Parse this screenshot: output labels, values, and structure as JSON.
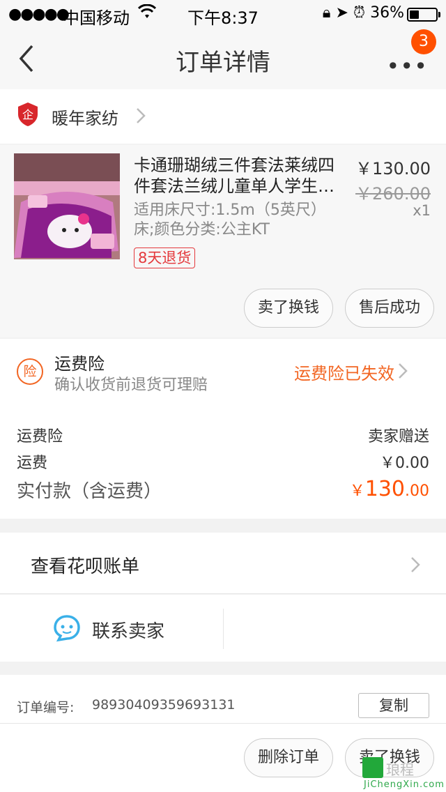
{
  "status_bar": {
    "signal": "●●●●●",
    "carrier": "中国移动",
    "time": "下午8:37",
    "battery_text": "36%",
    "battery_level": 0.36
  },
  "nav": {
    "title": "订单详情",
    "more": "•••",
    "badge": "3"
  },
  "shop": {
    "name": "暖年家纺"
  },
  "item": {
    "title_line1": "卡通珊瑚绒三件套法莱绒四",
    "title_line2": "件套法兰绒儿童单人学生…",
    "sku_line1": "适用床尺寸:1.5m（5英尺）",
    "sku_line2": "床;颜色分类:公主KT",
    "return_tag": "8天退货",
    "price": "￥130.00",
    "original_price": "￥260.00",
    "quantity": "x1",
    "buttons": {
      "resell": "卖了换钱",
      "after_sale": "售后成功"
    }
  },
  "insurance": {
    "icon_text": "险",
    "title": "运费险",
    "subtitle": "确认收货前退货可理赔",
    "status": "运费险已失效"
  },
  "fees": {
    "insurance_label": "运费险",
    "insurance_value": "卖家赠送",
    "shipping_label": "运费",
    "shipping_value": "￥0.00",
    "total_label": "实付款（含运费）",
    "total_currency": "￥",
    "total_int": "130",
    "total_dec": ".00"
  },
  "huabei": {
    "label": "查看花呗账单"
  },
  "contact": {
    "label": "联系卖家"
  },
  "order": {
    "number_label": "订单编号:",
    "number": "98930409359693131",
    "copy": "复制"
  },
  "bottom_actions": {
    "delete": "删除订单",
    "resell": "卖了换钱"
  },
  "watermark": {
    "brand": "琅程",
    "url": "JiChengXin.com"
  },
  "colors": {
    "accent": "#ff5000",
    "insurance": "#f26522",
    "return_tag": "#e4393c",
    "contact_icon": "#3ab0e8"
  }
}
